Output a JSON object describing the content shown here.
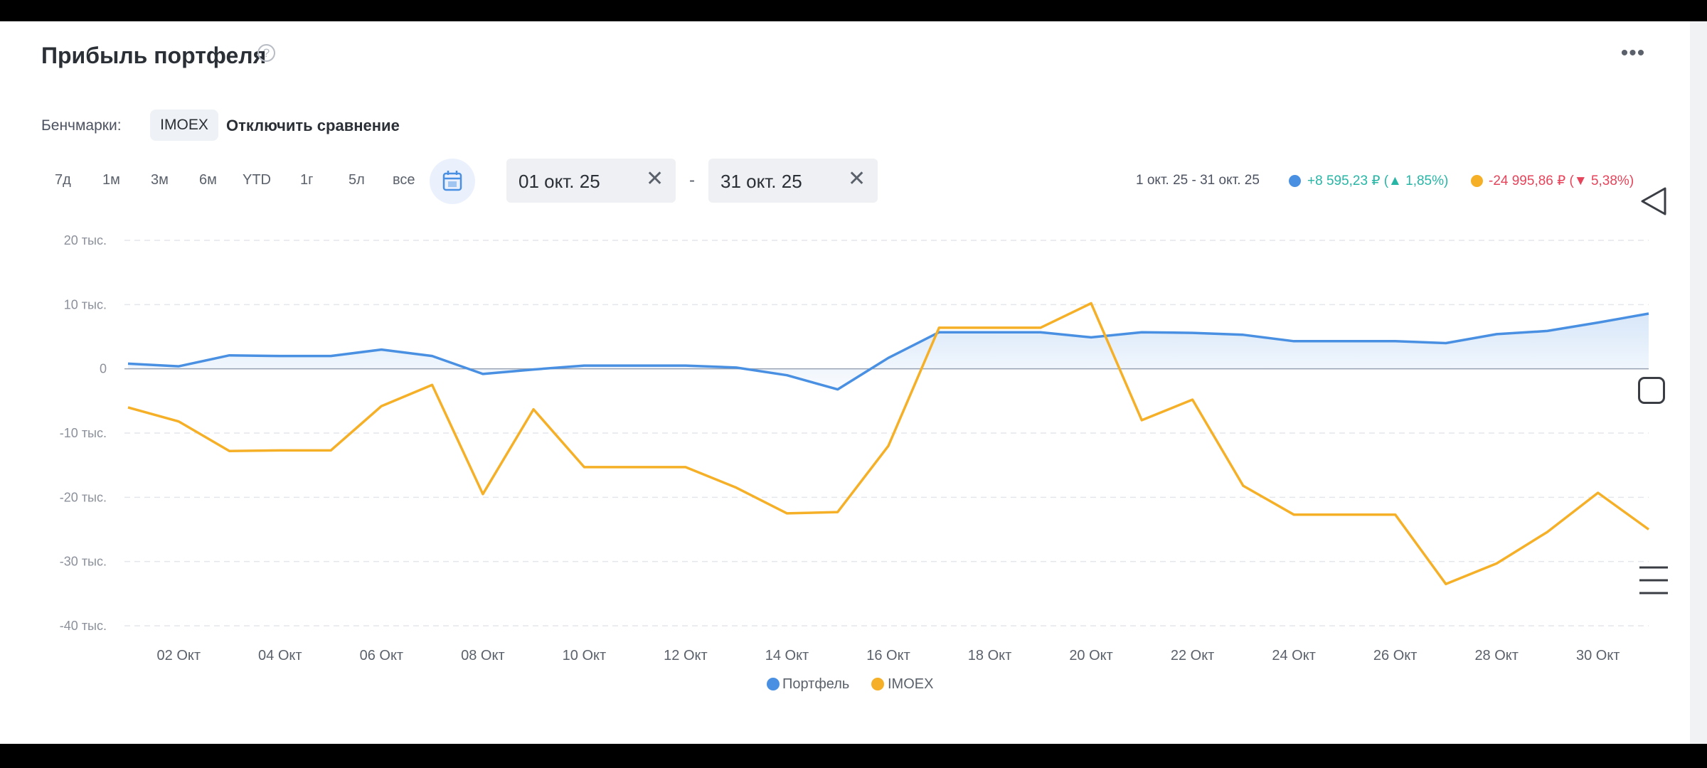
{
  "header": {
    "title": "Прибыль портфеля",
    "help_icon": "question-circle-icon",
    "more_icon": "more-horizontal-icon"
  },
  "benchmarks": {
    "label": "Бенчмарки:",
    "selected": "IMOEX",
    "disable_label": "Отключить сравнение"
  },
  "periods": [
    "7д",
    "1м",
    "3м",
    "6м",
    "YTD",
    "1г",
    "5л",
    "все"
  ],
  "calendar_icon": "calendar-icon",
  "date_range": {
    "from": "01 окт. 25",
    "to": "31 окт. 25",
    "separator": "-",
    "clear_icon": "close-icon"
  },
  "summary": {
    "range": "1 окт. 25 - 31 окт. 25",
    "portfolio_value": "+8 595,23 ₽",
    "portfolio_pct": "1,85%",
    "benchmark_value": "-24 995,86 ₽",
    "benchmark_pct": "5,38%",
    "paren_open": "(",
    "paren_close": ")"
  },
  "colors": {
    "portfolio": "#4a90e2",
    "benchmark": "#f5b027",
    "positive": "#27b6a6",
    "negative": "#e6445a"
  },
  "chart_data": {
    "type": "line",
    "x": [
      "01 Окт",
      "02 Окт",
      "03 Окт",
      "04 Окт",
      "05 Окт",
      "06 Окт",
      "07 Окт",
      "08 Окт",
      "09 Окт",
      "10 Окт",
      "11 Окт",
      "12 Окт",
      "13 Окт",
      "14 Окт",
      "15 Окт",
      "16 Окт",
      "17 Окт",
      "18 Окт",
      "19 Окт",
      "20 Окт",
      "21 Окт",
      "22 Окт",
      "23 Окт",
      "24 Окт",
      "25 Окт",
      "26 Окт",
      "27 Окт",
      "28 Окт",
      "29 Окт",
      "30 Окт",
      "31 Окт"
    ],
    "x_tick_labels": [
      "02 Окт",
      "04 Окт",
      "06 Окт",
      "08 Окт",
      "10 Окт",
      "12 Окт",
      "14 Окт",
      "16 Окт",
      "18 Окт",
      "20 Окт",
      "22 Окт",
      "24 Окт",
      "26 Окт",
      "28 Окт",
      "30 Окт"
    ],
    "y_ticks": [
      20000,
      10000,
      0,
      -10000,
      -20000,
      -30000,
      -40000
    ],
    "y_tick_labels": [
      "20 тыс.",
      "10 тыс.",
      "0",
      "-10 тыс.",
      "-20 тыс.",
      "-30 тыс.",
      "-40 тыс."
    ],
    "ylim": [
      -40000,
      20000
    ],
    "grid": true,
    "legend_position": "bottom",
    "series": [
      {
        "name": "Портфель",
        "values": [
          800,
          400,
          2100,
          2000,
          2000,
          3000,
          2000,
          -800,
          -100,
          500,
          500,
          500,
          200,
          -1000,
          -3200,
          1700,
          5700,
          5700,
          5700,
          4900,
          5700,
          5600,
          5300,
          4300,
          4300,
          4300,
          4000,
          5400,
          5900,
          7200,
          8600
        ]
      },
      {
        "name": "IMOEX",
        "values": [
          -6000,
          -8200,
          -12800,
          -12700,
          -12700,
          -5800,
          -2500,
          -19500,
          -6300,
          -15300,
          -15300,
          -15300,
          -18500,
          -22500,
          -22300,
          -12000,
          6400,
          6400,
          6400,
          10200,
          -8000,
          -4800,
          -18200,
          -22700,
          -22700,
          -22700,
          -33500,
          -30300,
          -25400,
          -19300,
          -25000
        ]
      }
    ]
  },
  "system_nav": {
    "back_icon": "nav-back-icon",
    "home_icon": "nav-home-icon",
    "recent_icon": "nav-recent-apps-icon"
  }
}
